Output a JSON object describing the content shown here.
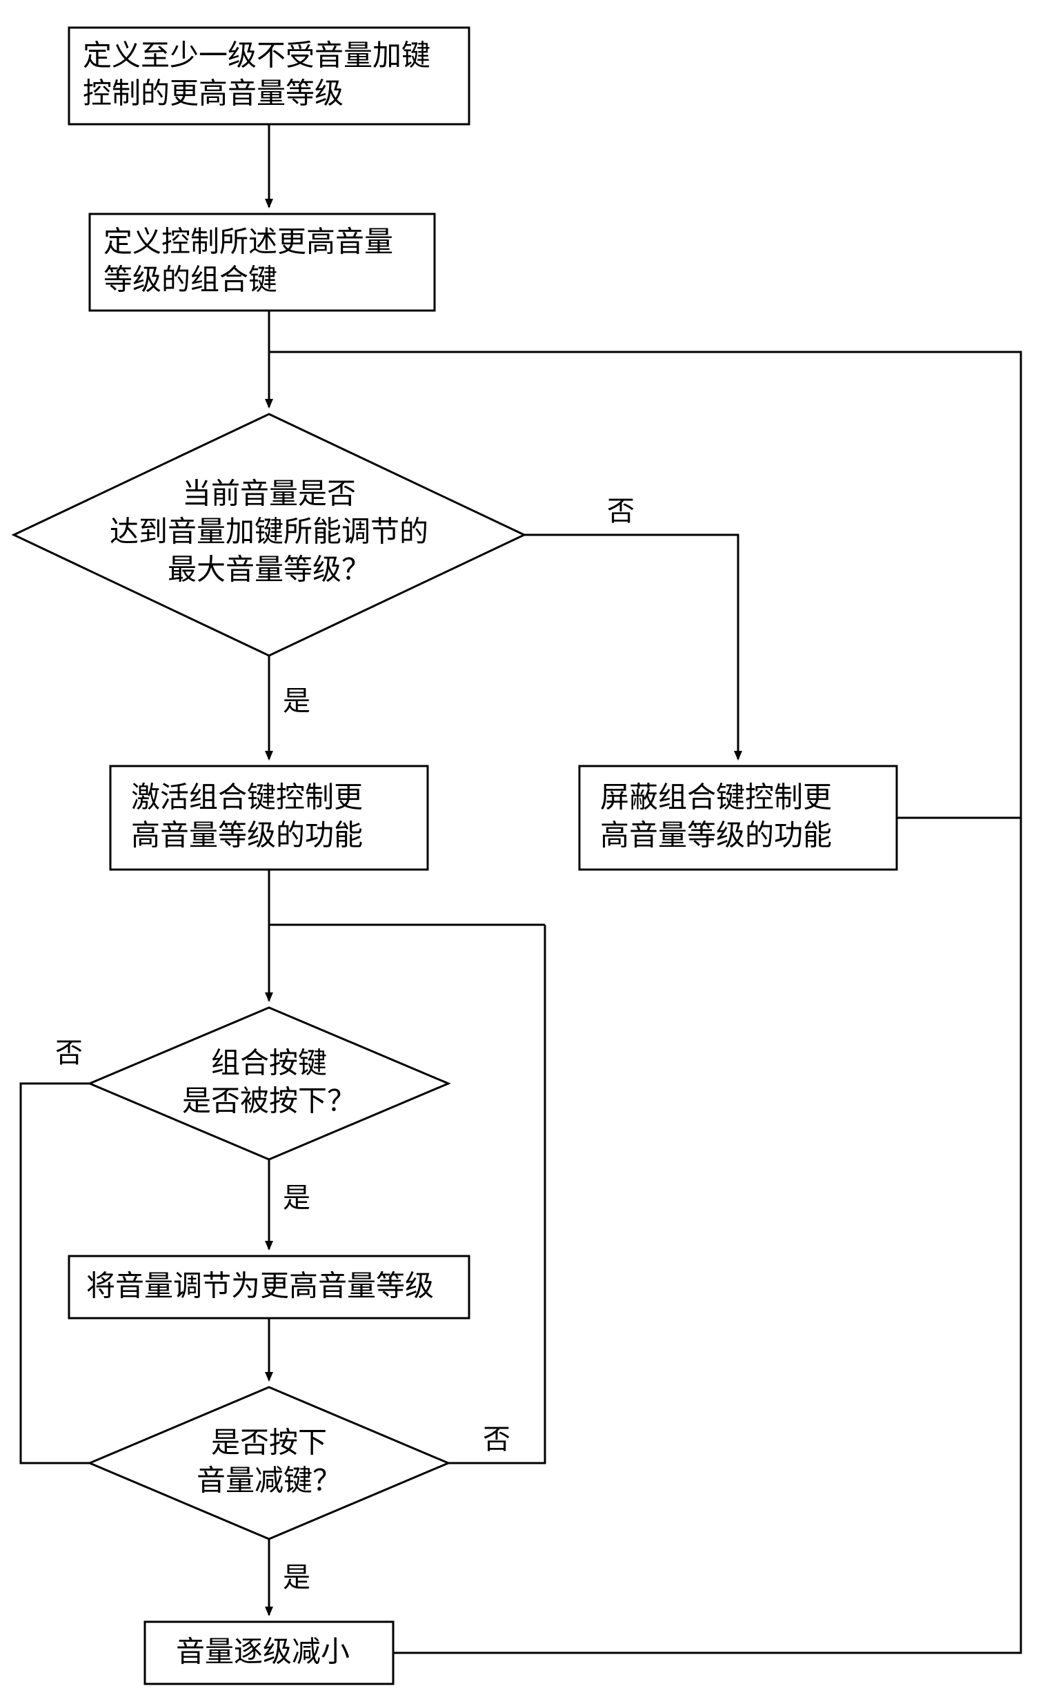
{
  "flowchart": {
    "nodes": {
      "step1": {
        "line1": "定义至少一级不受音量加键",
        "line2": "控制的更高音量等级"
      },
      "step2": {
        "line1": "定义控制所述更高音量",
        "line2": "等级的组合键"
      },
      "decision1": {
        "line1": "当前音量是否",
        "line2": "达到音量加键所能调节的",
        "line3": "最大音量等级？"
      },
      "step3_yes": {
        "line1": "激活组合键控制更",
        "line2": "高音量等级的功能"
      },
      "step3_no": {
        "line1": "屏蔽组合键控制更",
        "line2": "高音量等级的功能"
      },
      "decision2": {
        "line1": "组合按键",
        "line2": "是否被按下？"
      },
      "step4": "将音量调节为更高音量等级",
      "decision3": {
        "line1": "是否按下",
        "line2": "音量减键？"
      },
      "step5": "音量逐级减小"
    },
    "labels": {
      "yes": "是",
      "no": "否"
    }
  }
}
